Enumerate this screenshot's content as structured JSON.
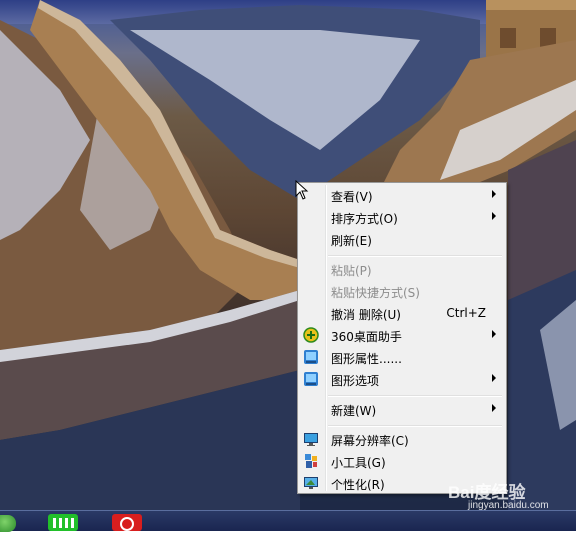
{
  "desktop": {
    "wallpaper": "great-wall-snow"
  },
  "taskbar": {
    "items": [
      {
        "icon": "start-orb-icon"
      },
      {
        "icon": "iqiyi-app-icon",
        "color": "#22c02a"
      },
      {
        "icon": "netease-music-app-icon",
        "color": "#d81e1e"
      }
    ]
  },
  "context_menu": {
    "items": [
      {
        "label": "查看(V)",
        "submenu": true
      },
      {
        "label": "排序方式(O)",
        "submenu": true
      },
      {
        "label": "刷新(E)"
      },
      {
        "label": "粘贴(P)",
        "disabled": true
      },
      {
        "label": "粘贴快捷方式(S)",
        "disabled": true
      },
      {
        "label": "撤消 删除(U)",
        "shortcut": "Ctrl+Z"
      },
      {
        "label": "360桌面助手",
        "submenu": true,
        "icon": "360-assistant-icon"
      },
      {
        "label": "图形属性......",
        "icon": "graphics-properties-icon"
      },
      {
        "label": "图形选项",
        "submenu": true,
        "icon": "graphics-options-icon"
      },
      {
        "label": "新建(W)",
        "submenu": true
      },
      {
        "label": "屏幕分辨率(C)",
        "icon": "screen-resolution-icon"
      },
      {
        "label": "小工具(G)",
        "icon": "gadgets-icon"
      },
      {
        "label": "个性化(R)",
        "icon": "personalize-icon"
      }
    ]
  },
  "watermark": {
    "brand": "Bai度经验",
    "url": "jingyan.baidu.com"
  }
}
